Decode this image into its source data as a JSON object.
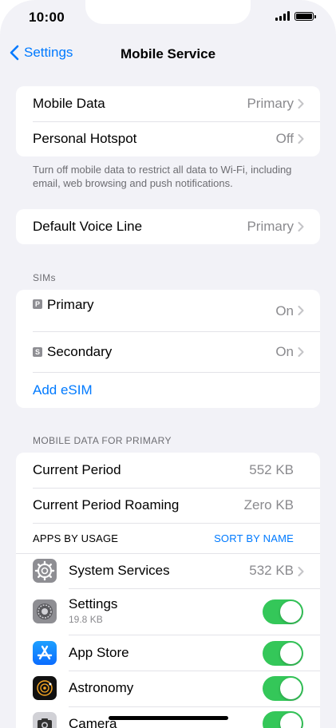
{
  "status_bar": {
    "time": "10:00"
  },
  "nav": {
    "back_label": "Settings",
    "title": "Mobile Service"
  },
  "group1": {
    "rows": [
      {
        "label": "Mobile Data",
        "value": "Primary"
      },
      {
        "label": "Personal Hotspot",
        "value": "Off"
      }
    ],
    "footnote": "Turn off mobile data to restrict all data to Wi-Fi, including email, web browsing and push notifications."
  },
  "group2": {
    "rows": [
      {
        "label": "Default Voice Line",
        "value": "Primary"
      }
    ]
  },
  "sims": {
    "header": "SIMs",
    "items": [
      {
        "badge": "P",
        "label": "Primary",
        "value": "On"
      },
      {
        "badge": "S",
        "label": "Secondary",
        "value": "On"
      }
    ],
    "add_label": "Add eSIM"
  },
  "usage": {
    "header": "MOBILE DATA FOR PRIMARY",
    "current_period": {
      "label": "Current Period",
      "value": "552 KB"
    },
    "current_roaming": {
      "label": "Current Period Roaming",
      "value": "Zero KB"
    },
    "apps_header": "APPS BY USAGE",
    "sort_label": "SORT BY NAME",
    "apps": [
      {
        "name": "System Services",
        "value": "532 KB",
        "icon": "gear-icon"
      },
      {
        "name": "Settings",
        "sub": "19.8 KB",
        "enabled": true,
        "icon": "settings-icon"
      },
      {
        "name": "App Store",
        "enabled": true,
        "icon": "app-store-icon"
      },
      {
        "name": "Astronomy",
        "enabled": true,
        "icon": "astronomy-icon"
      },
      {
        "name": "Camera",
        "enabled": true,
        "icon": "camera-icon"
      }
    ]
  },
  "colors": {
    "accent": "#007aff",
    "toggle_on": "#34c759",
    "background": "#f2f2f7"
  }
}
